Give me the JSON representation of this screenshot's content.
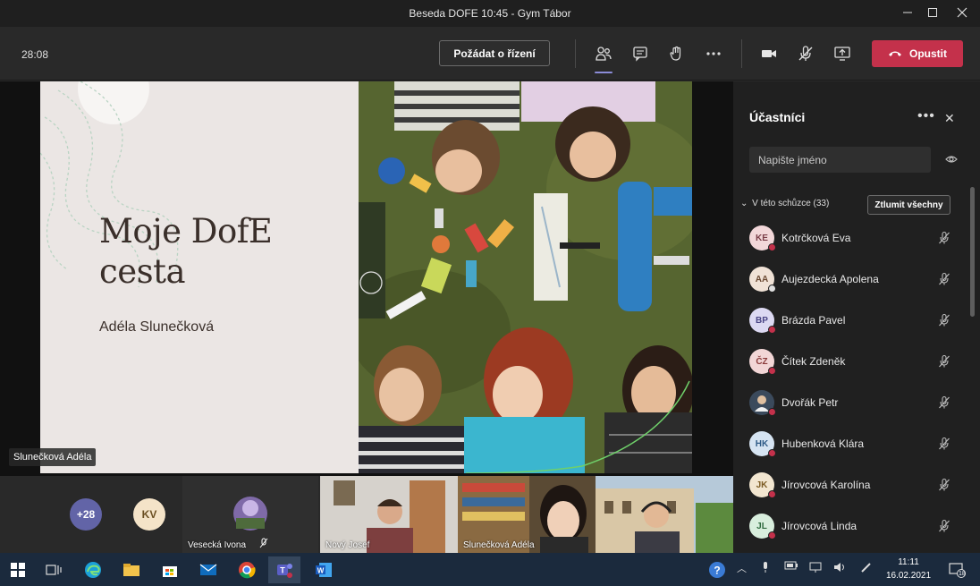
{
  "window": {
    "title": "Beseda DOFE 10:45 - Gym Tábor"
  },
  "toolbar": {
    "timer": "28:08",
    "request_control": "Požádat o řízení",
    "leave": "Opustit",
    "icons": [
      "participants-icon",
      "chat-icon",
      "raise-hand-icon",
      "more-icon",
      "camera-icon",
      "mic-off-icon",
      "share-icon"
    ]
  },
  "slide": {
    "title_line1": "Moje DofE",
    "title_line2": "cesta",
    "subtitle": "Adéla Slunečková",
    "presenter": "Slunečková Adéla"
  },
  "panel": {
    "title": "Účastníci",
    "search_placeholder": "Napište jméno",
    "section": "V této schůzce (33)",
    "mute_all": "Ztlumit všechny",
    "participants": [
      {
        "initials": "KE",
        "name": "Kotrčková Eva",
        "bg": "#f2d7d9",
        "fg": "#7a3e48"
      },
      {
        "initials": "AA",
        "name": "Aujezdecká Apolena",
        "bg": "#f0e2d6",
        "fg": "#6b4a33"
      },
      {
        "initials": "BP",
        "name": "Brázda Pavel",
        "bg": "#dcd9f2",
        "fg": "#4a4585"
      },
      {
        "initials": "ČZ",
        "name": "Čítek Zdeněk",
        "bg": "#f2d6d6",
        "fg": "#8a3a3a"
      },
      {
        "initials": "",
        "name": "Dvořák Petr",
        "bg": "#3b4a5c",
        "fg": "#ffffff"
      },
      {
        "initials": "HK",
        "name": "Hubenková Klára",
        "bg": "#d6e4f2",
        "fg": "#2e5a86"
      },
      {
        "initials": "JK",
        "name": "Jírovcová Karolína",
        "bg": "#f2e6d0",
        "fg": "#7a5a22"
      },
      {
        "initials": "JL",
        "name": "Jírovcová Linda",
        "bg": "#d8eedd",
        "fg": "#2f6b3f"
      }
    ]
  },
  "strip": {
    "more_count": "+28",
    "kv_initials": "KV",
    "tiles": [
      "Vesecká Ivona",
      "Nový Josef",
      "Slunečková Adéla",
      ""
    ]
  },
  "taskbar": {
    "time": "11:11",
    "date": "16.02.2021",
    "notification_count": "18"
  }
}
